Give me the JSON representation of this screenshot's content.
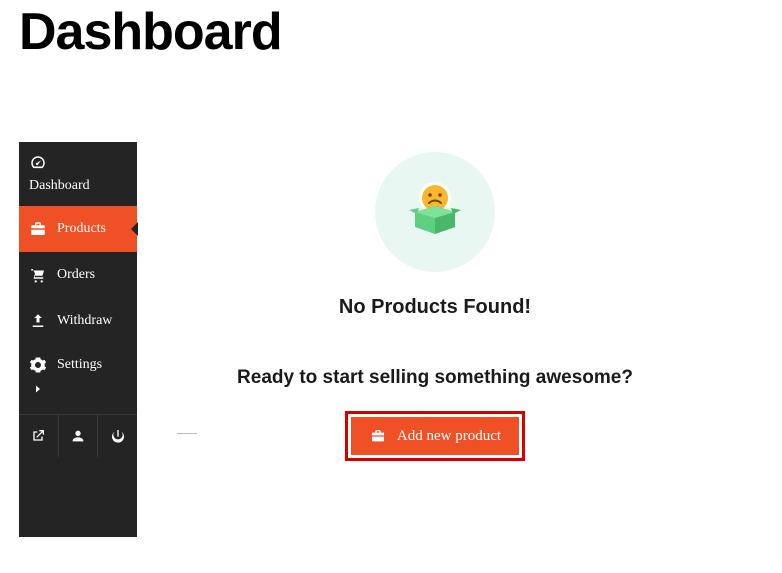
{
  "page": {
    "title": "Dashboard"
  },
  "sidebar": {
    "items": [
      {
        "label": "Dashboard"
      },
      {
        "label": "Products"
      },
      {
        "label": "Orders"
      },
      {
        "label": "Withdraw"
      },
      {
        "label": "Settings"
      }
    ]
  },
  "empty": {
    "heading": "No Products Found!",
    "subheading": "Ready to start selling something awesome?",
    "button_label": "Add new product"
  },
  "colors": {
    "accent": "#f05025",
    "callout": "#d40000"
  }
}
